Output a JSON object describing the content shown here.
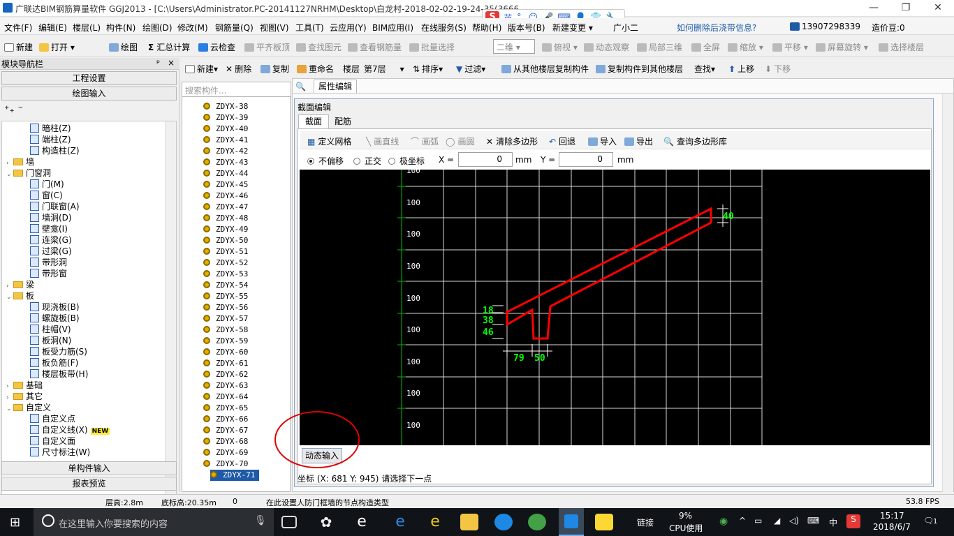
{
  "window": {
    "title": "广联达BIM钢筋算量软件 GGJ2013 - [C:\\Users\\Administrator.PC-20141127NRHM\\Desktop\\白龙村-2018-02-02-19-24-35(3666版).GGJ12]"
  },
  "ime": {
    "lang": "英"
  },
  "menu": [
    "文件(F)",
    "编辑(E)",
    "楼层(L)",
    "构件(N)",
    "绘图(D)",
    "修改(M)",
    "钢筋量(Q)",
    "视图(V)",
    "工具(T)",
    "云应用(Y)",
    "BIM应用(I)",
    "在线服务(S)",
    "帮助(H)",
    "版本号(B)",
    "新建变更 ▾",
    "广小二"
  ],
  "help_link": "如何删除后浇带信息?",
  "account": {
    "phone": "13907298339",
    "credit": "造价豆:0"
  },
  "toolbar1": {
    "new": "新建",
    "open": "打开",
    "draw": "绘图",
    "sum": "汇总计算",
    "cloud_check": "云检查",
    "align_top": "平齐板顶",
    "find_elem": "查找图元",
    "view_rebar": "查看钢筋量",
    "batch_select": "批量选择",
    "view_mode": "二维",
    "top_view": "俯视",
    "dyn_view": "动态观察",
    "local_3d": "局部三维",
    "fullscreen": "全屏",
    "zoom": "缩放",
    "pan": "平移",
    "rotate": "屏幕旋转",
    "select_floor": "选择楼层"
  },
  "toolbar2": {
    "new": "新建",
    "delete": "删除",
    "copy": "复制",
    "rename": "重命名",
    "floor_label": "楼层",
    "floor_value": "第7层",
    "sort": "排序",
    "filter": "过滤",
    "copy_from": "从其他楼层复制构件",
    "copy_to": "复制构件到其他楼层",
    "find": "查找",
    "up": "上移",
    "down": "下移"
  },
  "nav": {
    "header": "模块导航栏",
    "project_settings": "工程设置",
    "draw_input": "绘图输入",
    "single_input": "单构件输入",
    "report_preview": "报表预览",
    "tree": [
      {
        "label": "暗柱(Z)",
        "level": 2
      },
      {
        "label": "端柱(Z)",
        "level": 2
      },
      {
        "label": "构造柱(Z)",
        "level": 2
      },
      {
        "label": "墙",
        "level": 0,
        "folder": true,
        "toggle": "›"
      },
      {
        "label": "门窗洞",
        "level": 0,
        "folder": true,
        "toggle": "⌄"
      },
      {
        "label": "门(M)",
        "level": 2
      },
      {
        "label": "窗(C)",
        "level": 2
      },
      {
        "label": "门联窗(A)",
        "level": 2
      },
      {
        "label": "墙洞(D)",
        "level": 2
      },
      {
        "label": "壁龛(I)",
        "level": 2
      },
      {
        "label": "连梁(G)",
        "level": 2
      },
      {
        "label": "过梁(G)",
        "level": 2
      },
      {
        "label": "带形洞",
        "level": 2
      },
      {
        "label": "带形窗",
        "level": 2
      },
      {
        "label": "梁",
        "level": 0,
        "folder": true,
        "toggle": "›"
      },
      {
        "label": "板",
        "level": 0,
        "folder": true,
        "toggle": "⌄"
      },
      {
        "label": "现浇板(B)",
        "level": 2
      },
      {
        "label": "螺旋板(B)",
        "level": 2
      },
      {
        "label": "柱帽(V)",
        "level": 2
      },
      {
        "label": "板洞(N)",
        "level": 2
      },
      {
        "label": "板受力筋(S)",
        "level": 2
      },
      {
        "label": "板负筋(F)",
        "level": 2
      },
      {
        "label": "楼层板带(H)",
        "level": 2
      },
      {
        "label": "基础",
        "level": 0,
        "folder": true,
        "toggle": "›"
      },
      {
        "label": "其它",
        "level": 0,
        "folder": true,
        "toggle": "›"
      },
      {
        "label": "自定义",
        "level": 0,
        "folder": true,
        "toggle": "⌄"
      },
      {
        "label": "自定义点",
        "level": 2
      },
      {
        "label": "自定义线(X)",
        "level": 2,
        "badge": "NEW"
      },
      {
        "label": "自定义面",
        "level": 2
      },
      {
        "label": "尺寸标注(W)",
        "level": 2
      }
    ]
  },
  "search_placeholder": "搜索构件...",
  "components": [
    "ZDYX-38",
    "ZDYX-39",
    "ZDYX-40",
    "ZDYX-41",
    "ZDYX-42",
    "ZDYX-43",
    "ZDYX-44",
    "ZDYX-45",
    "ZDYX-46",
    "ZDYX-47",
    "ZDYX-48",
    "ZDYX-49",
    "ZDYX-50",
    "ZDYX-51",
    "ZDYX-52",
    "ZDYX-53",
    "ZDYX-54",
    "ZDYX-55",
    "ZDYX-56",
    "ZDYX-57",
    "ZDYX-58",
    "ZDYX-59",
    "ZDYX-60",
    "ZDYX-61",
    "ZDYX-62",
    "ZDYX-63",
    "ZDYX-64",
    "ZDYX-65",
    "ZDYX-66",
    "ZDYX-67",
    "ZDYX-68",
    "ZDYX-69",
    "ZDYX-70",
    "ZDYX-71"
  ],
  "selected_component": "ZDYX-71",
  "prop_tab": "属性编辑",
  "dialog": {
    "title": "截面编辑",
    "tabs": [
      "截面",
      "配筋"
    ],
    "tools": {
      "grid": "定义网格",
      "line": "画直线",
      "arc": "画弧",
      "circle": "画圆",
      "clear": "清除多边形",
      "undo": "回退",
      "import": "导入",
      "export": "导出",
      "query": "查询多边形库"
    },
    "offset": {
      "none": "不偏移",
      "ortho": "正交",
      "polar": "极坐标",
      "x_label": "X =",
      "x_value": "0",
      "y_label": "Y =",
      "y_value": "0",
      "unit": "mm"
    },
    "grid_labels": [
      "100",
      "100",
      "100",
      "100",
      "100",
      "100",
      "100",
      "100",
      "100"
    ],
    "dims": {
      "d18": "18",
      "d38": "38",
      "d46": "46",
      "d79": "79",
      "d50": "50",
      "d40": "40"
    },
    "dyn_input": "动态输入",
    "coord_status": "坐标 (X: 681 Y: 945) 请选择下一点"
  },
  "status": {
    "floor_height": "层高:2.8m",
    "bottom_height": "底标高:20.35m",
    "zero": "0",
    "hint": "在此设置人防门框墙的节点构造类型",
    "fps": "53.8 FPS"
  },
  "taskbar": {
    "search_placeholder": "在这里输入你要搜索的内容",
    "link": "链接",
    "cpu_pct": "9%",
    "cpu_label": "CPU使用",
    "lang": "中",
    "time": "15:17",
    "date": "2018/6/7",
    "notif": "1"
  },
  "colors": {
    "accent": "#1e5aa8",
    "shape": "#ff0000",
    "dim": "#00ff00",
    "grid": "#ffffff"
  }
}
